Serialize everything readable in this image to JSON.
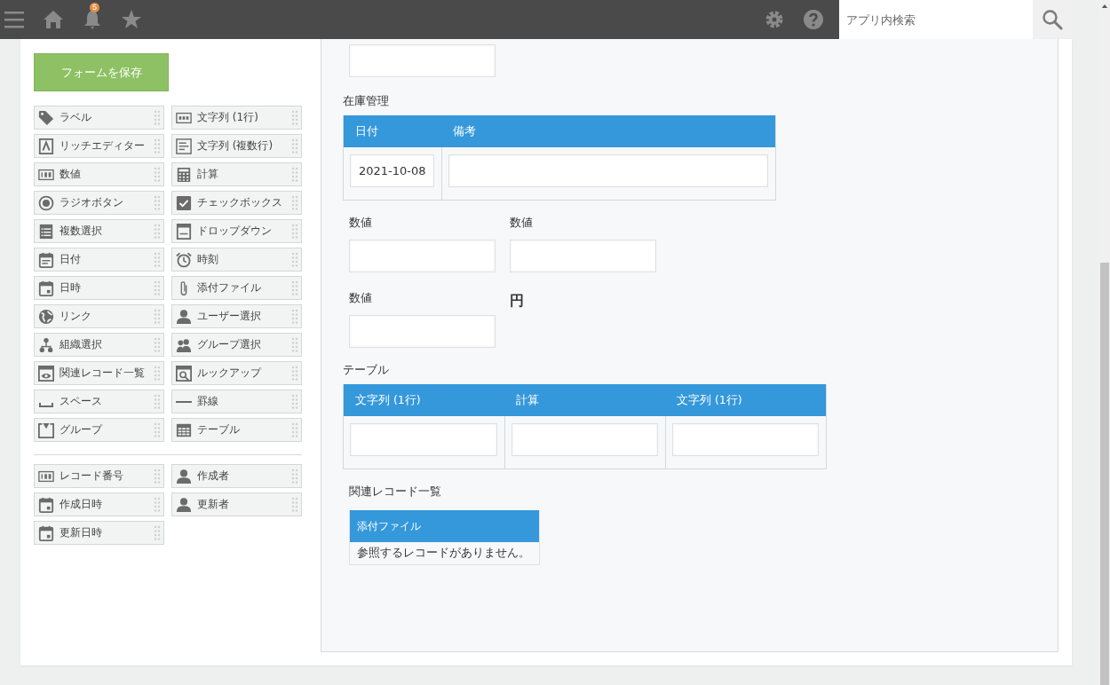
{
  "header": {
    "notification_count": "5",
    "search": {
      "placeholder": "アプリ内検索"
    }
  },
  "save_button": "フォームを保存",
  "palette": {
    "fields": [
      {
        "label": "ラベル"
      },
      {
        "label": "文字列 (1行)"
      },
      {
        "label": "リッチエディター"
      },
      {
        "label": "文字列 (複数行)"
      },
      {
        "label": "数値"
      },
      {
        "label": "計算"
      },
      {
        "label": "ラジオボタン"
      },
      {
        "label": "チェックボックス"
      },
      {
        "label": "複数選択"
      },
      {
        "label": "ドロップダウン"
      },
      {
        "label": "日付"
      },
      {
        "label": "時刻"
      },
      {
        "label": "日時"
      },
      {
        "label": "添付ファイル"
      },
      {
        "label": "リンク"
      },
      {
        "label": "ユーザー選択"
      },
      {
        "label": "組織選択"
      },
      {
        "label": "グループ選択"
      },
      {
        "label": "関連レコード一覧"
      },
      {
        "label": "ルックアップ"
      },
      {
        "label": "スペース"
      },
      {
        "label": "罫線"
      },
      {
        "label": "グループ"
      },
      {
        "label": "テーブル"
      }
    ],
    "system_fields": [
      {
        "label": "レコード番号"
      },
      {
        "label": "作成者"
      },
      {
        "label": "作成日時"
      },
      {
        "label": "更新者"
      },
      {
        "label": "更新日時"
      }
    ]
  },
  "form": {
    "items": [
      {
        "kind": "input"
      },
      {
        "kind": "subtable",
        "label": "在庫管理",
        "columns": [
          {
            "header": "日付",
            "value": "2021-10-08"
          },
          {
            "header": "備考"
          }
        ]
      },
      {
        "kind": "row",
        "cells": [
          {
            "kind": "input",
            "label": "数値"
          },
          {
            "kind": "input",
            "label": "数値"
          }
        ]
      },
      {
        "kind": "row",
        "cells": [
          {
            "kind": "input",
            "label": "数値"
          },
          {
            "kind": "unit",
            "text": "円"
          }
        ]
      },
      {
        "kind": "subtable",
        "label": "テーブル",
        "columns": [
          {
            "header": "文字列 (1行)"
          },
          {
            "header": "計算"
          },
          {
            "header": "文字列 (1行)"
          }
        ]
      },
      {
        "kind": "reference",
        "label": "関連レコード一覧",
        "columns": [
          {
            "header": "添付ファイル"
          }
        ],
        "message": "参照するレコードがありません。"
      }
    ]
  }
}
